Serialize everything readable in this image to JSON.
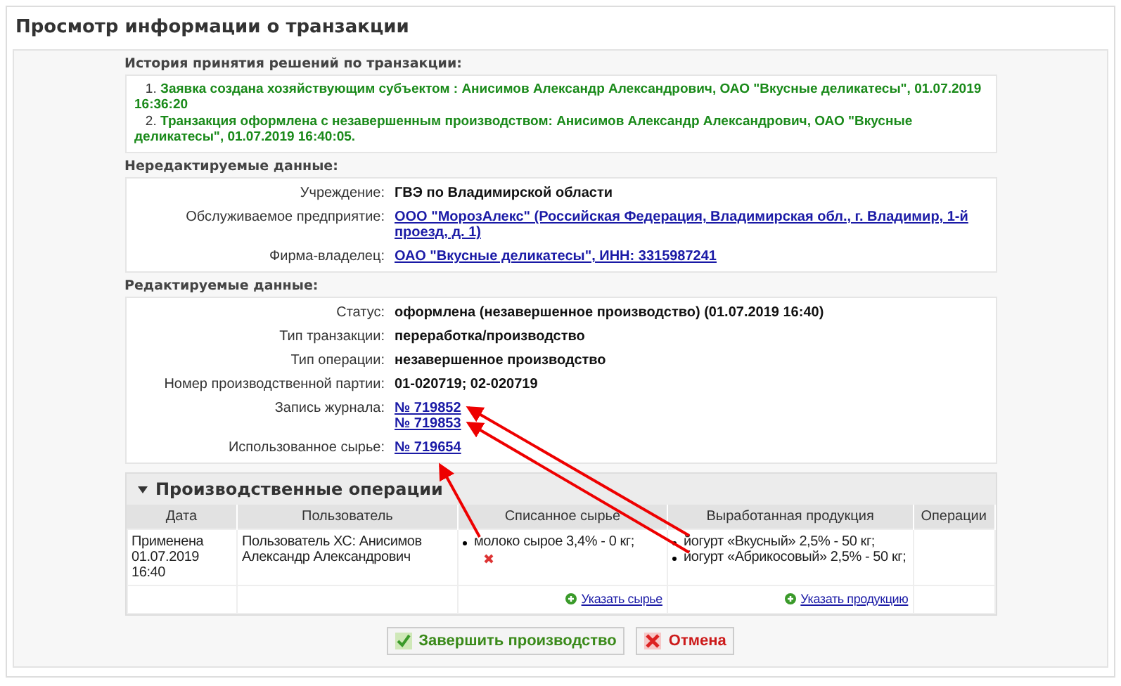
{
  "title": "Просмотр информации о транзакции",
  "history": {
    "label": "История принятия решений по транзакции:",
    "items": [
      {
        "number": "1.",
        "text": "Заявка создана хозяйствующим субъектом : Анисимов Александр Александрович, ОАО \"Вкусные деликатесы\", 01.07.2019 16:36:20"
      },
      {
        "number": "2.",
        "text": "Транзакция оформлена с незавершенным производством: Анисимов Александр Александрович, ОАО \"Вкусные деликатесы\", 01.07.2019 16:40:05."
      }
    ]
  },
  "readonly": {
    "label": "Нередактируемые данные:",
    "rows": [
      {
        "label": "Учреждение:",
        "values": [
          {
            "kind": "text",
            "text": "ГВЭ по Владимирской области"
          }
        ]
      },
      {
        "label": "Обслуживаемое предприятие:",
        "values": [
          {
            "kind": "link",
            "text": "ООО \"МорозАлекс\" (Российская Федерация, Владимирская обл., г. Владимир, 1-й проезд, д. 1)"
          }
        ]
      },
      {
        "label": "Фирма-владелец:",
        "values": [
          {
            "kind": "link",
            "text": "ОАО \"Вкусные деликатесы\", ИНН: 3315987241"
          }
        ]
      }
    ]
  },
  "editable": {
    "label": "Редактируемые данные:",
    "rows": [
      {
        "label": "Статус:",
        "values": [
          {
            "kind": "text",
            "text": "оформлена (незавершенное производство) (01.07.2019 16:40)"
          }
        ]
      },
      {
        "label": "Тип транзакции:",
        "values": [
          {
            "kind": "text",
            "text": "переработка/производство"
          }
        ]
      },
      {
        "label": "Тип операции:",
        "values": [
          {
            "kind": "text",
            "text": "незавершенное производство"
          }
        ]
      },
      {
        "label": "Номер производственной партии:",
        "values": [
          {
            "kind": "text",
            "text": "01-020719; 02-020719"
          }
        ]
      },
      {
        "label": "Запись журнала:",
        "values": [
          {
            "kind": "link",
            "text": "№ 719852"
          },
          {
            "kind": "link",
            "text": "№ 719853"
          }
        ]
      },
      {
        "label": "Использованное сырье:",
        "values": [
          {
            "kind": "link",
            "text": "№ 719654"
          }
        ]
      }
    ]
  },
  "operations": {
    "title": "Производственные операции",
    "expanded": true,
    "columns": [
      "Дата",
      "Пользователь",
      "Списанное сырье",
      "Выработанная продукция",
      "Операции"
    ],
    "rows": [
      {
        "date": "Применена 01.07.2019 16:40",
        "user": "Пользователь ХС: Анисимов Александр Александрович",
        "raw": [
          "молоко сырое 3,4% - 0 кг;"
        ],
        "products": [
          "йогурт «Вкусный» 2,5% - 50 кг;",
          "йогурт «Абрикосовый» 2,5% - 50 кг;"
        ]
      }
    ],
    "add_raw": "Указать сырье",
    "add_product": "Указать продукцию"
  },
  "buttons": [
    {
      "kind": "confirm",
      "label": "Завершить производство"
    },
    {
      "kind": "cancel",
      "label": "Отмена"
    }
  ]
}
